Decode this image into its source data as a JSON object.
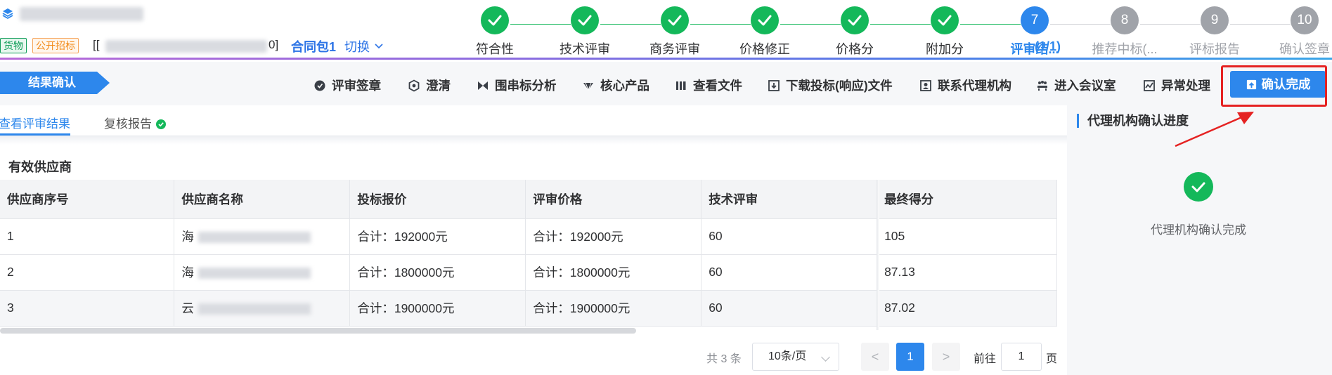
{
  "header": {
    "tags": [
      "货物",
      "公开招标"
    ],
    "project_bracket_open": "[[",
    "project_bracket_close": "0]",
    "package": "合同包1",
    "switch": "切换"
  },
  "steps": [
    {
      "label": "符合性",
      "status": "done"
    },
    {
      "label": "技术评审",
      "status": "done"
    },
    {
      "label": "商务评审",
      "status": "done"
    },
    {
      "label": "价格修正",
      "status": "done"
    },
    {
      "label": "价格分",
      "status": "done"
    },
    {
      "label": "附加分",
      "status": "done"
    },
    {
      "label": "评审结...",
      "status": "active",
      "number": "7",
      "count": "(1/1)"
    },
    {
      "label": "推荐中标(...",
      "status": "pending",
      "number": "8"
    },
    {
      "label": "评标报告",
      "status": "pending",
      "number": "9"
    },
    {
      "label": "确认签章",
      "status": "pending",
      "number": "10"
    }
  ],
  "toolbar": {
    "stage": "结果确认",
    "items": [
      "评审签章",
      "澄清",
      "围串标分析",
      "核心产品",
      "查看文件",
      "下载投标(响应)文件",
      "联系代理机构",
      "进入会议室",
      "异常处理"
    ],
    "confirm": "确认完成"
  },
  "tabs": {
    "active": "查看评审结果",
    "review": "复核报告"
  },
  "section_title": "有效供应商",
  "table": {
    "columns": [
      "供应商序号",
      "供应商名称",
      "投标报价",
      "评审价格",
      "技术评审",
      "最终得分"
    ],
    "rows": [
      {
        "no": "1",
        "name": "海",
        "bid": "合计：192000元",
        "eval": "合计：192000元",
        "tech": "60",
        "score": "105"
      },
      {
        "no": "2",
        "name": "海",
        "bid": "合计：1800000元",
        "eval": "合计：1800000元",
        "tech": "60",
        "score": "87.13"
      },
      {
        "no": "3",
        "name": "云",
        "bid": "合计：1900000元",
        "eval": "合计：1900000元",
        "tech": "60",
        "score": "87.02"
      }
    ]
  },
  "pagination": {
    "total": "共 3 条",
    "page_size": "10条/页",
    "prev": "<",
    "page": "1",
    "next": ">",
    "goto_prefix": "前往",
    "goto_value": "1",
    "goto_suffix": "页"
  },
  "right_panel": {
    "title": "代理机构确认进度",
    "status": "代理机构确认完成"
  },
  "colors": {
    "accent": "#2d87ec",
    "done": "#14b85a",
    "pending": "#a0a3a9",
    "highlight": "#e52222"
  }
}
